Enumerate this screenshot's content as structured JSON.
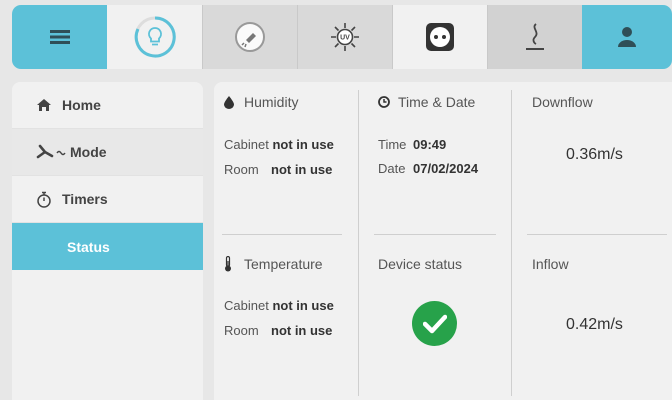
{
  "sidebar": {
    "items": [
      {
        "label": "Home",
        "icon": "home-icon"
      },
      {
        "label": "Mode",
        "icon": "fan-icon"
      },
      {
        "label": "Timers",
        "icon": "stopwatch-icon"
      },
      {
        "label": "Status",
        "icon": ""
      }
    ],
    "active": "Status"
  },
  "status": {
    "humidity": {
      "title": "Humidity",
      "cabinet_label": "Cabinet",
      "cabinet_value": "not in use",
      "room_label": "Room",
      "room_value": "not in use"
    },
    "time_date": {
      "title": "Time & Date",
      "time_label": "Time",
      "time_value": "09:49",
      "date_label": "Date",
      "date_value": "07/02/2024"
    },
    "downflow": {
      "title": "Downflow",
      "value": "0.36m/s"
    },
    "temperature": {
      "title": "Temperature",
      "cabinet_label": "Cabinet",
      "cabinet_value": "not in use",
      "room_label": "Room",
      "room_value": "not in use"
    },
    "device_status": {
      "title": "Device status",
      "icon": "check-circle-icon"
    },
    "inflow": {
      "title": "Inflow",
      "value": "0.42m/s"
    }
  },
  "colors": {
    "accent": "#5cc1d8",
    "ok": "#27a24a"
  }
}
